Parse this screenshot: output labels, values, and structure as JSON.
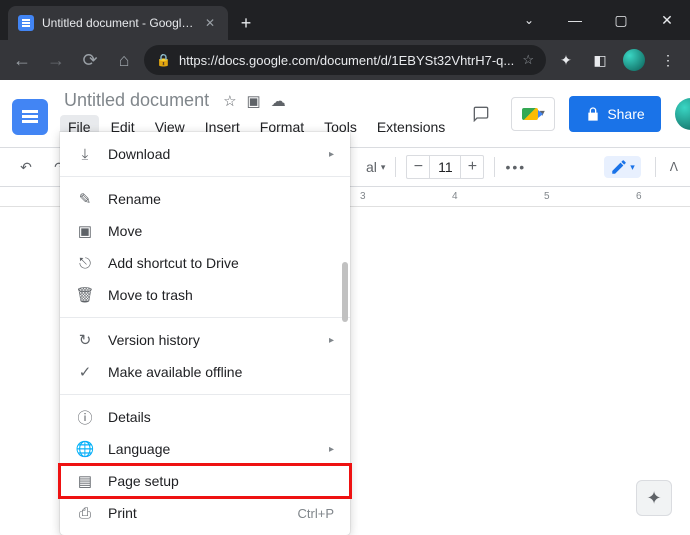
{
  "browser": {
    "tab_title": "Untitled document - Google Doc",
    "url": "https://docs.google.com/document/d/1EBYSt32VhtrH7-q..."
  },
  "docs": {
    "title": "Untitled document",
    "menubar": [
      "File",
      "Edit",
      "View",
      "Insert",
      "Format",
      "Tools",
      "Extensions"
    ],
    "active_menu_index": 0,
    "share_label": "Share",
    "toolbar": {
      "style_dropdown_suffix": "al",
      "font_size": "11"
    }
  },
  "ruler_ticks": [
    "3",
    "4",
    "5",
    "6"
  ],
  "file_menu": {
    "items": [
      {
        "icon": "download",
        "label": "Download",
        "submenu": true
      },
      {
        "divider": true
      },
      {
        "icon": "rename",
        "label": "Rename"
      },
      {
        "icon": "move",
        "label": "Move"
      },
      {
        "icon": "shortcut",
        "label": "Add shortcut to Drive"
      },
      {
        "icon": "trash",
        "label": "Move to trash"
      },
      {
        "divider": true
      },
      {
        "icon": "history",
        "label": "Version history",
        "submenu": true
      },
      {
        "icon": "offline",
        "label": "Make available offline"
      },
      {
        "divider": true
      },
      {
        "icon": "details",
        "label": "Details"
      },
      {
        "icon": "language",
        "label": "Language",
        "submenu": true
      },
      {
        "icon": "pagesetup",
        "label": "Page setup",
        "highlighted": true
      },
      {
        "icon": "print",
        "label": "Print",
        "shortcut": "Ctrl+P"
      }
    ]
  }
}
